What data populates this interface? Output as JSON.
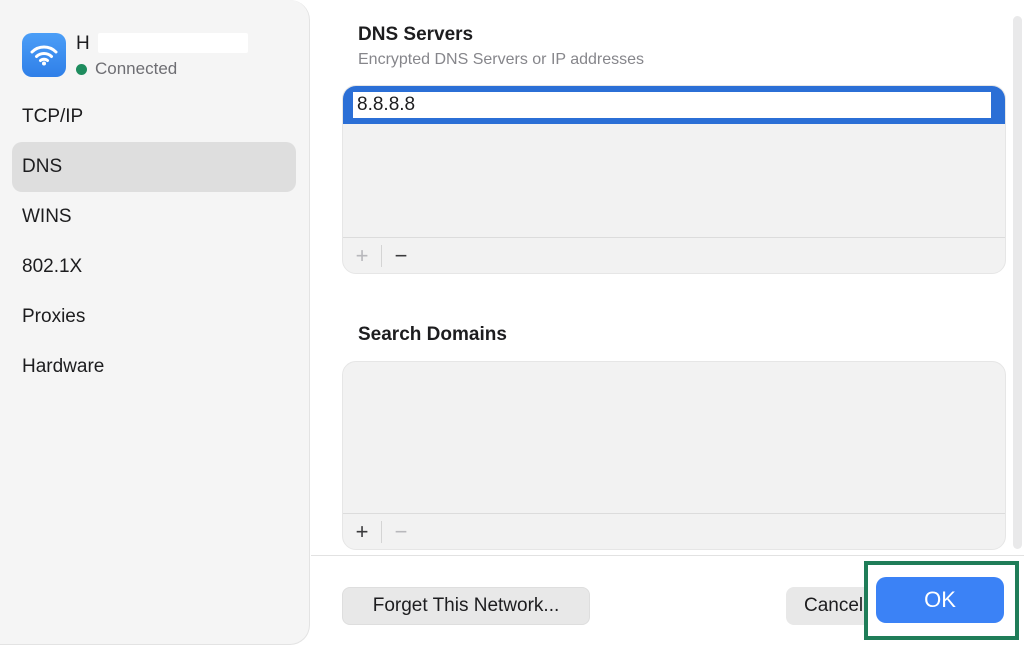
{
  "network": {
    "name": "H",
    "status": "Connected",
    "status_color": "#1e8c5e",
    "icon": "wifi-icon"
  },
  "sidebar": {
    "items": [
      {
        "label": "TCP/IP",
        "active": false
      },
      {
        "label": "DNS",
        "active": true
      },
      {
        "label": "WINS",
        "active": false
      },
      {
        "label": "802.1X",
        "active": false
      },
      {
        "label": "Proxies",
        "active": false
      },
      {
        "label": "Hardware",
        "active": false
      }
    ]
  },
  "dns": {
    "title": "DNS Servers",
    "subtitle": "Encrypted DNS Servers or IP addresses",
    "entries": [
      "8.8.8.8"
    ],
    "add_label": "+",
    "remove_label": "−"
  },
  "search_domains": {
    "title": "Search Domains",
    "entries": [],
    "add_label": "+",
    "remove_label": "−"
  },
  "footer": {
    "forget_label": "Forget This Network...",
    "cancel_label": "Cancel",
    "ok_label": "OK"
  },
  "colors": {
    "accent": "#3b82f6",
    "selection": "#2b6fd6",
    "highlight_frame": "#1f7d58"
  }
}
